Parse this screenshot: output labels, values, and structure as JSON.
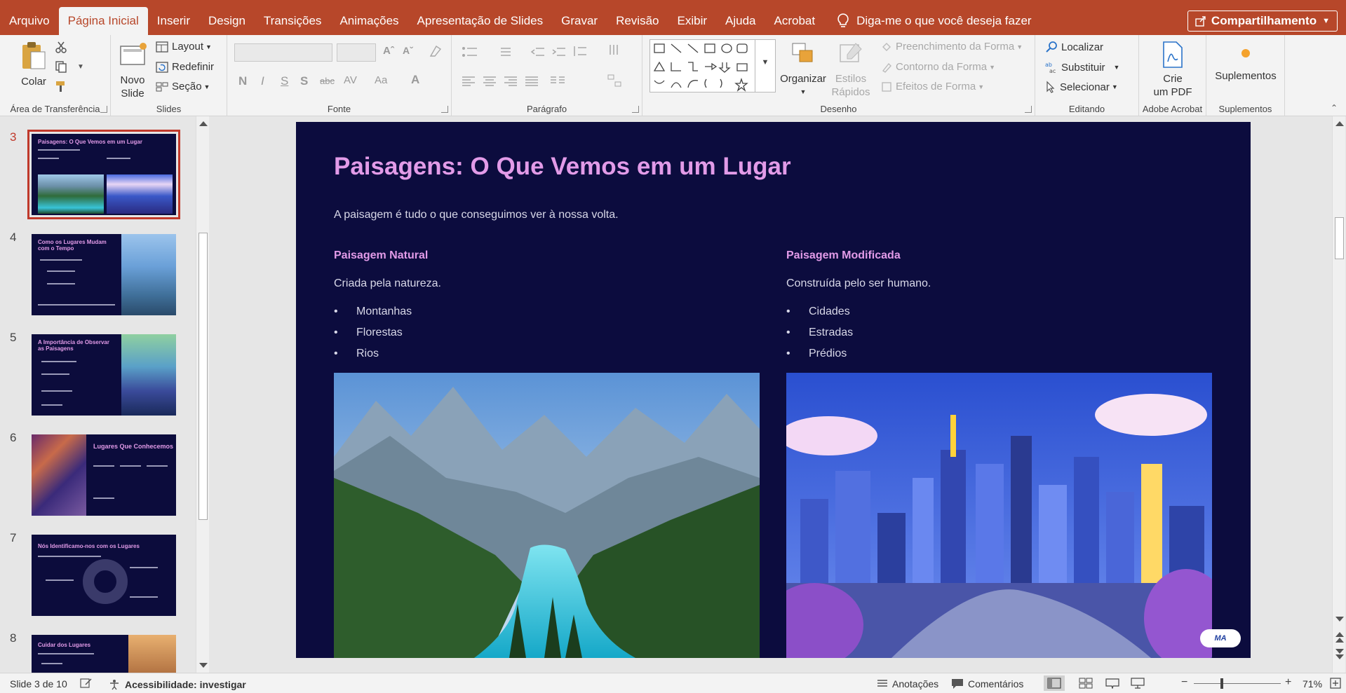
{
  "tabs": [
    {
      "label": "Arquivo",
      "active": false
    },
    {
      "label": "Página Inicial",
      "active": true
    },
    {
      "label": "Inserir",
      "active": false
    },
    {
      "label": "Design",
      "active": false
    },
    {
      "label": "Transições",
      "active": false
    },
    {
      "label": "Animações",
      "active": false
    },
    {
      "label": "Apresentação de Slides",
      "active": false
    },
    {
      "label": "Gravar",
      "active": false
    },
    {
      "label": "Revisão",
      "active": false
    },
    {
      "label": "Exibir",
      "active": false
    },
    {
      "label": "Ajuda",
      "active": false
    },
    {
      "label": "Acrobat",
      "active": false
    }
  ],
  "tell_me": "Diga-me o que você deseja fazer",
  "share": "Compartilhamento",
  "ribbon": {
    "clipboard": {
      "paste": "Colar",
      "label": "Área de Transferência"
    },
    "slides": {
      "new_slide_line1": "Novo",
      "new_slide_line2": "Slide",
      "layout": "Layout",
      "reset": "Redefinir",
      "section": "Seção",
      "label": "Slides"
    },
    "font": {
      "label": "Fonte",
      "bold": "N",
      "italic": "I",
      "underline": "S",
      "shadow": "S",
      "strike": "abc",
      "spacing": "AV",
      "case": "Aa",
      "color": "A"
    },
    "paragraph": {
      "label": "Parágrafo"
    },
    "drawing": {
      "arrange": "Organizar",
      "quick_styles_line1": "Estilos",
      "quick_styles_line2": "Rápidos",
      "shape_fill": "Preenchimento da Forma",
      "shape_outline": "Contorno da Forma",
      "shape_effects": "Efeitos de Forma",
      "label": "Desenho"
    },
    "editing": {
      "find": "Localizar",
      "replace": "Substituir",
      "select": "Selecionar",
      "label": "Editando"
    },
    "acrobat": {
      "create_line1": "Crie",
      "create_line2": "um PDF",
      "label": "Adobe Acrobat"
    },
    "addins": {
      "addins": "Suplementos",
      "label": "Suplementos"
    }
  },
  "thumbnails": [
    {
      "num": "3",
      "title": "Paisagens: O Que Vemos em um Lugar",
      "selected": true
    },
    {
      "num": "4",
      "title": "Como os Lugares Mudam com o Tempo",
      "selected": false
    },
    {
      "num": "5",
      "title": "A Importância de Observar as Paisagens",
      "selected": false
    },
    {
      "num": "6",
      "title": "Lugares Que Conhecemos",
      "selected": false
    },
    {
      "num": "7",
      "title": "Nós Identificamo-nos com os Lugares",
      "selected": false
    },
    {
      "num": "8",
      "title": "Cuidar dos Lugares",
      "selected": false
    }
  ],
  "slide": {
    "title": "Paisagens: O Que Vemos em um Lugar",
    "subtitle": "A paisagem é tudo o que conseguimos ver à nossa volta.",
    "left": {
      "heading": "Paisagem Natural",
      "desc": "Criada pela natureza.",
      "items": [
        "Montanhas",
        "Florestas",
        "Rios"
      ]
    },
    "right": {
      "heading": "Paisagem Modificada",
      "desc": "Construída pelo ser humano.",
      "items": [
        "Cidades",
        "Estradas",
        "Prédios"
      ]
    },
    "badge": "MA"
  },
  "status": {
    "slide_of": "Slide 3 de 10",
    "accessibility": "Acessibilidade: investigar",
    "notes": "Anotações",
    "comments": "Comentários",
    "zoom": "71%"
  },
  "colors": {
    "accent": "#b7472a",
    "slide_bg": "#0c0c3e",
    "title": "#e29be8"
  }
}
